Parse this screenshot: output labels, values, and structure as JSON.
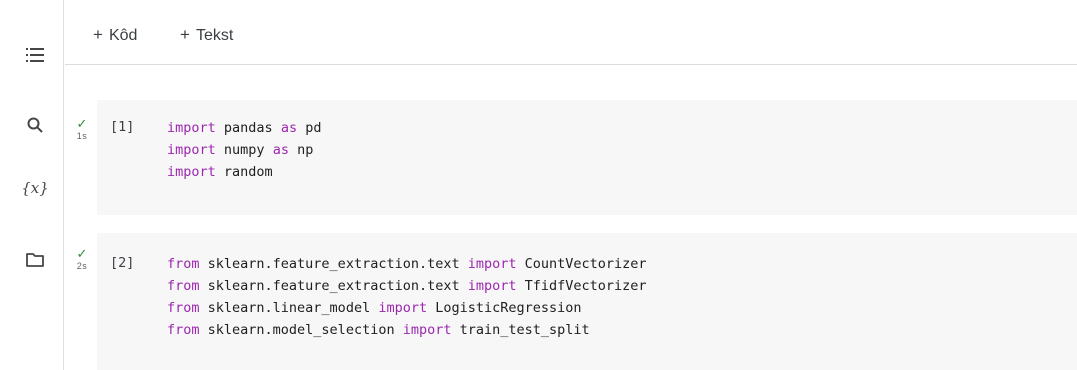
{
  "toolbar": {
    "add_code_label": "Kôd",
    "add_text_label": "Tekst",
    "plus": "+"
  },
  "sidebar": {
    "variables_label": "{x}"
  },
  "cells": [
    {
      "exec_count": "[1]",
      "status_check": "✓",
      "duration": "1s",
      "lines": [
        [
          {
            "t": "import",
            "k": true
          },
          {
            "t": " pandas ",
            "k": false
          },
          {
            "t": "as",
            "k": true
          },
          {
            "t": " pd",
            "k": false
          }
        ],
        [
          {
            "t": "import",
            "k": true
          },
          {
            "t": " numpy ",
            "k": false
          },
          {
            "t": "as",
            "k": true
          },
          {
            "t": " np",
            "k": false
          }
        ],
        [
          {
            "t": "import",
            "k": true
          },
          {
            "t": " random",
            "k": false
          }
        ]
      ]
    },
    {
      "exec_count": "[2]",
      "status_check": "✓",
      "duration": "2s",
      "lines": [
        [
          {
            "t": "from",
            "k": true
          },
          {
            "t": " sklearn.feature_extraction.text ",
            "k": false
          },
          {
            "t": "import",
            "k": true
          },
          {
            "t": " CountVectorizer",
            "k": false
          }
        ],
        [
          {
            "t": "from",
            "k": true
          },
          {
            "t": " sklearn.feature_extraction.text ",
            "k": false
          },
          {
            "t": "import",
            "k": true
          },
          {
            "t": " TfidfVectorizer",
            "k": false
          }
        ],
        [
          {
            "t": "from",
            "k": true
          },
          {
            "t": " sklearn.linear_model ",
            "k": false
          },
          {
            "t": "import",
            "k": true
          },
          {
            "t": " LogisticRegression",
            "k": false
          }
        ],
        [
          {
            "t": "from",
            "k": true
          },
          {
            "t": " sklearn.model_selection ",
            "k": false
          },
          {
            "t": "import",
            "k": true
          },
          {
            "t": " train_test_split",
            "k": false
          }
        ]
      ]
    }
  ],
  "colors": {
    "keyword": "#9c27b0",
    "success": "#2e8b3d",
    "cell_bg": "#f7f7f7"
  }
}
